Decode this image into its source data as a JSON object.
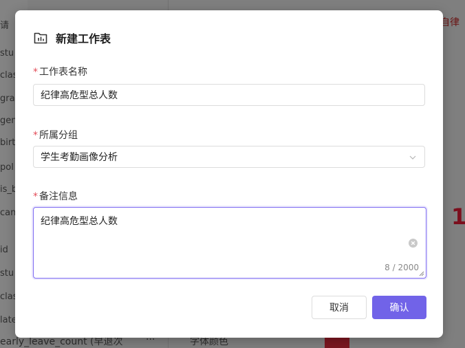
{
  "background": {
    "left_fields": [
      "stu",
      "clas",
      "gra",
      "gen",
      "birt",
      "pol",
      "is_b",
      "can",
      "id",
      "stu",
      "clas",
      "late"
    ],
    "top_left_text": "请",
    "right_text": "自律",
    "right_number": "1",
    "bottom_left_text": "early_leave_count (早退次",
    "bottom_dots": "···",
    "bottom_right_text": "字体颜色"
  },
  "modal": {
    "title": "新建工作表",
    "icon": "folder-chart-icon",
    "fields": {
      "name": {
        "label": "工作表名称",
        "required_mark": "*",
        "value": "纪律高危型总人数"
      },
      "group": {
        "label": "所属分组",
        "required_mark": "*",
        "value": "学生考勤画像分析"
      },
      "remark": {
        "label": "备注信息",
        "required_mark": "*",
        "value": "纪律高危型总人数",
        "counter": "8 / 2000"
      }
    },
    "buttons": {
      "cancel": "取消",
      "confirm": "确认"
    }
  },
  "colors": {
    "primary": "#7163e8",
    "required": "#e34d59",
    "overlay": "#7f7f7f"
  }
}
